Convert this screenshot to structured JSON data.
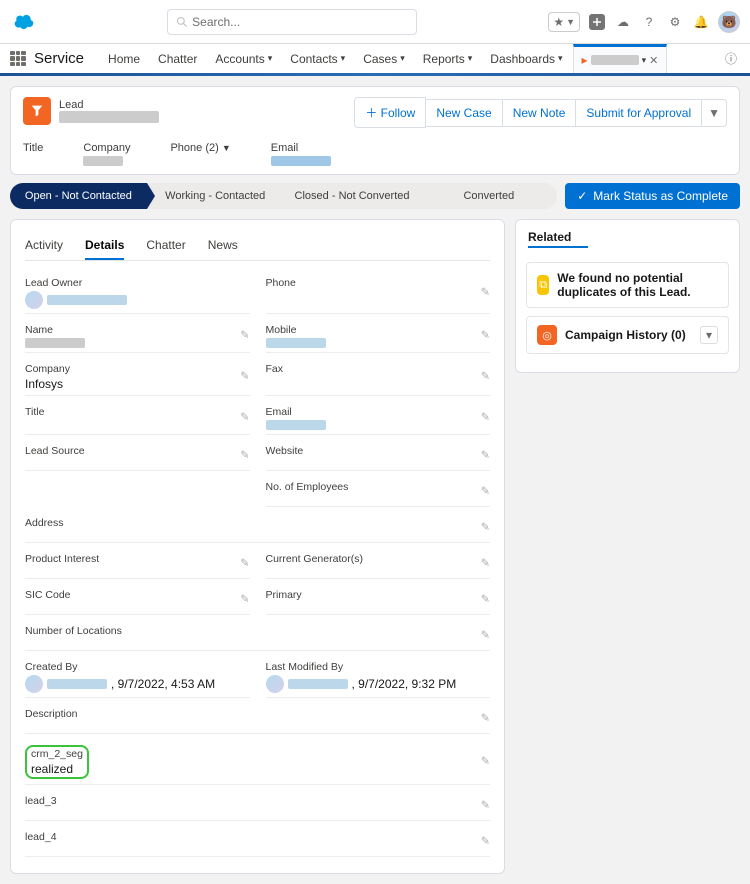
{
  "header": {
    "search_placeholder": "Search...",
    "app_name": "Service",
    "nav": [
      "Home",
      "Chatter",
      "Accounts",
      "Contacts",
      "Cases",
      "Reports",
      "Dashboards"
    ],
    "active_tab_label": "████████"
  },
  "record": {
    "object_label": "Lead",
    "name": "████████████",
    "actions": {
      "follow": "Follow",
      "new_case": "New Case",
      "new_note": "New Note",
      "submit": "Submit for Approval"
    },
    "summary_fields": {
      "title_label": "Title",
      "company_label": "Company",
      "company_value": "██████",
      "phone_label": "Phone (2)",
      "email_label": "Email",
      "email_value": "██████████"
    }
  },
  "path": {
    "steps": [
      "Open - Not Contacted",
      "Working - Contacted",
      "Closed - Not Converted",
      "Converted"
    ],
    "mark_complete": "Mark Status as Complete"
  },
  "tabs": {
    "activity": "Activity",
    "details": "Details",
    "chatter": "Chatter",
    "news": "News"
  },
  "details": {
    "lead_owner": {
      "label": "Lead Owner",
      "value": "████████████"
    },
    "phone": {
      "label": "Phone"
    },
    "name": {
      "label": "Name",
      "value": "██████████"
    },
    "mobile": {
      "label": "Mobile",
      "value": "██████████"
    },
    "company": {
      "label": "Company",
      "value": "Infosys"
    },
    "fax": {
      "label": "Fax"
    },
    "title": {
      "label": "Title"
    },
    "email": {
      "label": "Email",
      "value": "██████████"
    },
    "lead_source": {
      "label": "Lead Source"
    },
    "website": {
      "label": "Website"
    },
    "no_employees": {
      "label": "No. of Employees"
    },
    "address": {
      "label": "Address"
    },
    "product_interest": {
      "label": "Product Interest"
    },
    "current_generators": {
      "label": "Current Generator(s)"
    },
    "sic_code": {
      "label": "SIC Code"
    },
    "primary": {
      "label": "Primary"
    },
    "num_locations": {
      "label": "Number of Locations"
    },
    "created_by": {
      "label": "Created By",
      "meta": ", 9/7/2022, 4:53 AM",
      "user": "████████"
    },
    "last_modified_by": {
      "label": "Last Modified By",
      "meta": ", 9/7/2022, 9:32 PM",
      "user": "████████"
    },
    "description": {
      "label": "Description"
    },
    "crm_2_seg": {
      "label": "crm_2_seg",
      "value": "realized"
    },
    "lead_3": {
      "label": "lead_3"
    },
    "lead_4": {
      "label": "lead_4"
    }
  },
  "related": {
    "title": "Related",
    "duplicates": "We found no potential duplicates of this Lead.",
    "campaign_history": "Campaign History (0)"
  }
}
